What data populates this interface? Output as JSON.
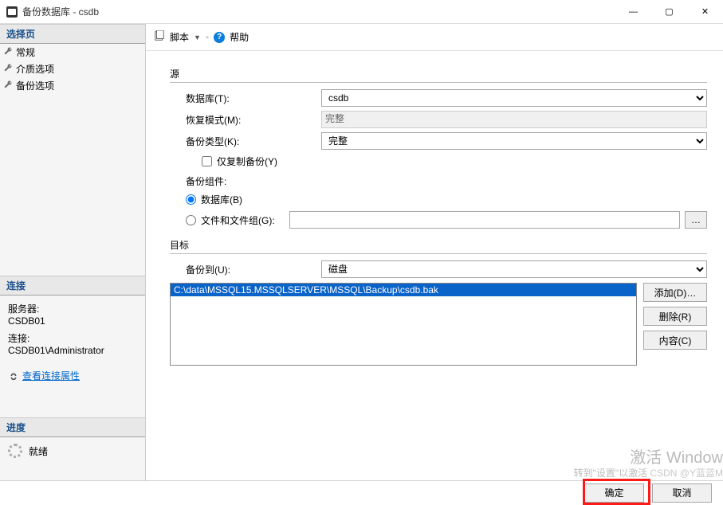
{
  "window": {
    "title": "备份数据库 - csdb"
  },
  "left": {
    "select_page": "选择页",
    "nav": {
      "general": "常规",
      "media": "介质选项",
      "backup": "备份选项"
    },
    "connection_header": "连接",
    "server_label": "服务器:",
    "server_value": "CSDB01",
    "conn_label": "连接:",
    "conn_value": "CSDB01\\Administrator",
    "view_props": "查看连接属性",
    "progress_header": "进度",
    "progress_status": "就绪"
  },
  "toolbar": {
    "script": "脚本",
    "help": "帮助"
  },
  "form": {
    "source_header": "源",
    "database_label": "数据库(T):",
    "database_value": "csdb",
    "recovery_label": "恢复模式(M):",
    "recovery_value": "完整",
    "backup_type_label": "备份类型(K):",
    "backup_type_value": "完整",
    "copy_only": "仅复制备份(Y)",
    "component_label": "备份组件:",
    "radio_db": "数据库(B)",
    "radio_fg": "文件和文件组(G):",
    "dest_header": "目标",
    "backup_to_label": "备份到(U):",
    "backup_to_value": "磁盘",
    "dest_path": "C:\\data\\MSSQL15.MSSQLSERVER\\MSSQL\\Backup\\csdb.bak",
    "btn_add": "添加(D)…",
    "btn_remove": "删除(R)",
    "btn_contents": "内容(C)"
  },
  "footer": {
    "ok": "确定",
    "cancel": "取消"
  },
  "watermark": {
    "line1": "激活 Window",
    "line2": "转到\"设置\"以激活",
    "credit": "CSDN @Y蓝蓝M"
  }
}
